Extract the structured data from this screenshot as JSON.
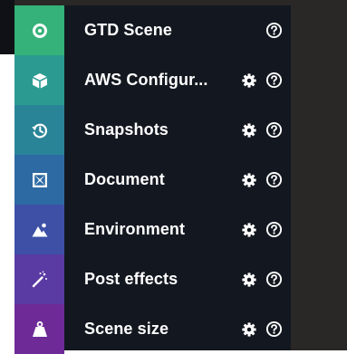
{
  "panel": {
    "items": [
      {
        "label": "GTD Scene",
        "icon": "target-icon",
        "color": "#35b27a",
        "has_settings": false
      },
      {
        "label": "AWS Configur...",
        "icon": "cube-icon",
        "color": "#2b9b92",
        "has_settings": true
      },
      {
        "label": "Snapshots",
        "icon": "history-icon",
        "color": "#2a8497",
        "has_settings": true
      },
      {
        "label": "Document",
        "icon": "document-frame-icon",
        "color": "#2d6aa3",
        "has_settings": true
      },
      {
        "label": "Environment",
        "icon": "environment-icon",
        "color": "#3d50a6",
        "has_settings": true
      },
      {
        "label": "Post effects",
        "icon": "magic-wand-icon",
        "color": "#5a3aa3",
        "has_settings": true
      },
      {
        "label": "Scene size",
        "icon": "weight-icon",
        "color": "#6e2b97",
        "has_settings": true
      }
    ]
  }
}
